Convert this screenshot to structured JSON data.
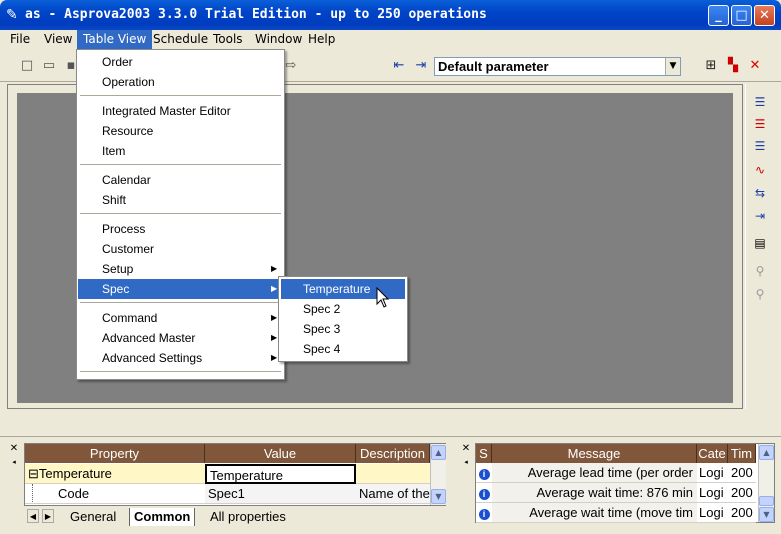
{
  "window": {
    "title": "as - Asprova2003 3.3.0 Trial Edition  - up to 250 operations",
    "app_icon": "pen-icon",
    "minimize": "_",
    "maximize": "□",
    "close": "✕"
  },
  "menubar": [
    "File",
    "View",
    "Table View",
    "Schedule",
    "Tools",
    "Window",
    "Help"
  ],
  "toolbar": {
    "parameter": "Default parameter"
  },
  "table_view_menu": {
    "groups": [
      [
        "Order",
        "Operation"
      ],
      [
        "Integrated Master Editor",
        "Resource",
        "Item"
      ],
      [
        "Calendar",
        "Shift"
      ],
      [
        "Process",
        "Customer",
        "Setup",
        "Spec"
      ],
      [
        "Command",
        "Advanced Master",
        "Advanced Settings"
      ]
    ],
    "highlighted": "Spec"
  },
  "spec_submenu": {
    "items": [
      "Temperature",
      "Spec 2",
      "Spec 3",
      "Spec 4"
    ],
    "highlighted": "Temperature"
  },
  "property_panel": {
    "columns": [
      "Property",
      "Value",
      "Description"
    ],
    "rows": [
      {
        "expander": "⊟",
        "property": "Temperature",
        "value": "Temperature",
        "description": ""
      },
      {
        "expander": "",
        "property": "Code",
        "value": "Spec1",
        "description": "Name of the"
      }
    ],
    "tabs": [
      "General",
      "Common",
      "All properties"
    ],
    "active_tab": "Common"
  },
  "message_panel": {
    "columns": [
      "S",
      "Message",
      "Cate",
      "Tim"
    ],
    "rows": [
      {
        "status": "i",
        "message": "Average lead time (per order",
        "category": "Logi",
        "time": "200"
      },
      {
        "status": "i",
        "message": "Average wait time: 876 min",
        "category": "Logi",
        "time": "200"
      },
      {
        "status": "i",
        "message": "Average wait time (move tim",
        "category": "Logi",
        "time": "200"
      }
    ]
  },
  "colors": {
    "title_bar": "#0a5fd8",
    "menu_highlight": "#316ac5",
    "grid_header": "#80573a",
    "selected_row": "#fff8c6",
    "workspace": "#808080"
  }
}
